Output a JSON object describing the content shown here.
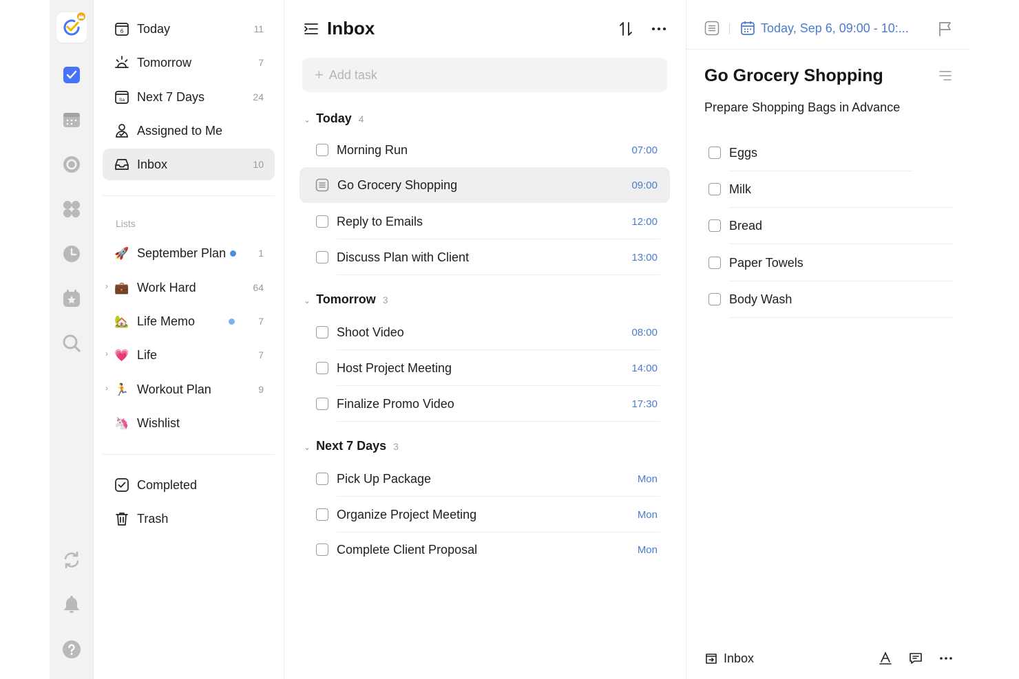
{
  "colors": {
    "accent": "#4772fa",
    "link_blue": "#4a7bd0",
    "badge_dot": "#4a90e2"
  },
  "sidebar": {
    "smart": [
      {
        "label": "Today",
        "count": "11",
        "icon": "calendar-today-icon"
      },
      {
        "label": "Tomorrow",
        "count": "7",
        "icon": "sunrise-icon"
      },
      {
        "label": "Next 7 Days",
        "count": "24",
        "icon": "calendar-week-icon"
      },
      {
        "label": "Assigned to Me",
        "count": "",
        "icon": "person-icon"
      },
      {
        "label": "Inbox",
        "count": "10",
        "icon": "inbox-icon"
      }
    ],
    "lists_label": "Lists",
    "lists": [
      {
        "label": "September Plan",
        "count": "1",
        "emoji": "🚀"
      },
      {
        "label": "Work Hard",
        "count": "64",
        "emoji": "💼"
      },
      {
        "label": "Life Memo",
        "count": "7",
        "emoji": "🏡"
      },
      {
        "label": "Life",
        "count": "7",
        "emoji": "💗"
      },
      {
        "label": "Workout Plan",
        "count": "9",
        "emoji": "🏃"
      },
      {
        "label": "Wishlist",
        "count": "",
        "emoji": "🦄"
      }
    ],
    "bottom": [
      {
        "label": "Completed",
        "icon": "checkbox-checked-icon"
      },
      {
        "label": "Trash",
        "icon": "trash-icon"
      }
    ]
  },
  "tasklist": {
    "title": "Inbox",
    "add_placeholder": "Add task",
    "groups": [
      {
        "name": "Today",
        "count": "4",
        "tasks": [
          {
            "name": "Morning Run",
            "time": "07:00"
          },
          {
            "name": "Go Grocery Shopping",
            "time": "09:00"
          },
          {
            "name": "Reply to Emails",
            "time": "12:00"
          },
          {
            "name": "Discuss Plan with Client",
            "time": "13:00"
          }
        ]
      },
      {
        "name": "Tomorrow",
        "count": "3",
        "tasks": [
          {
            "name": "Shoot Video",
            "time": "08:00"
          },
          {
            "name": "Host Project Meeting",
            "time": "14:00"
          },
          {
            "name": "Finalize Promo Video",
            "time": "17:30"
          }
        ]
      },
      {
        "name": "Next 7 Days",
        "count": "3",
        "tasks": [
          {
            "name": "Pick Up Package",
            "time": "Mon"
          },
          {
            "name": "Organize Project Meeting",
            "time": "Mon"
          },
          {
            "name": "Complete Client Proposal",
            "time": "Mon"
          }
        ]
      }
    ]
  },
  "detail": {
    "date": "Today, Sep 6, 09:00 - 10:...",
    "title": "Go Grocery Shopping",
    "description": "Prepare Shopping Bags in Advance",
    "subtasks": [
      "Eggs",
      "Milk",
      "Bread",
      "Paper Towels",
      "Body Wash"
    ],
    "project": "Inbox"
  }
}
